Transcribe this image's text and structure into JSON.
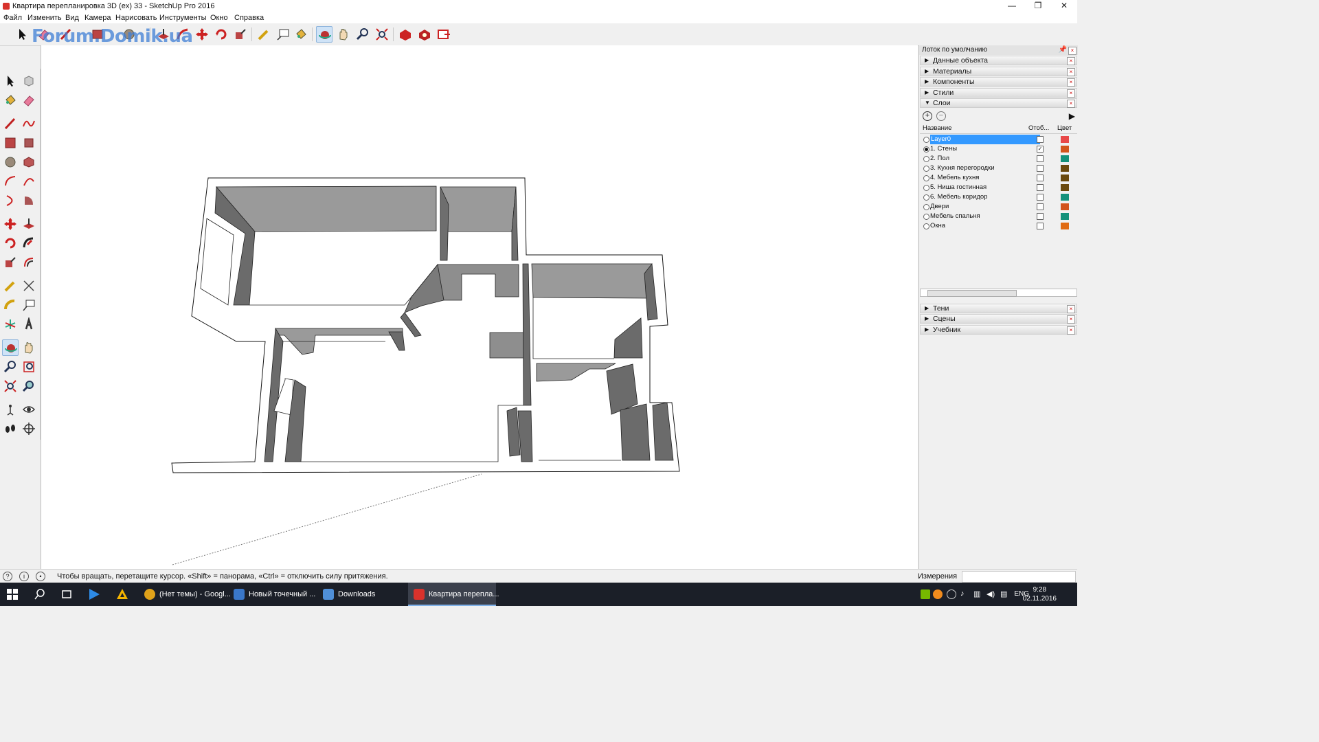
{
  "window": {
    "title": "Квартира перепланировка 3D (ex) 33 - SketchUp Pro 2016"
  },
  "menu": [
    "Файл",
    "Изменить",
    "Вид",
    "Камера",
    "Нарисовать",
    "Инструменты",
    "Окно",
    "Справка"
  ],
  "watermark": "Forum.Domik.ua",
  "tray": {
    "title": "Лоток по умолчанию",
    "panels_top": [
      "Данные объекта",
      "Материалы",
      "Компоненты",
      "Стили",
      "Слои"
    ],
    "panels_bottom": [
      "Тени",
      "Сцены",
      "Учебник"
    ],
    "layers_header": {
      "name": "Название",
      "visible": "Отоб...",
      "color": "Цвет"
    },
    "layers": [
      {
        "name": "Layer0",
        "active": false,
        "visible": false,
        "color": "#e84848",
        "selected": true
      },
      {
        "name": "1. Стены",
        "active": true,
        "visible": true,
        "color": "#d2541c",
        "selected": false
      },
      {
        "name": "2. Пол",
        "active": false,
        "visible": false,
        "color": "#14917a",
        "selected": false
      },
      {
        "name": "3. Кухня перегородки",
        "active": false,
        "visible": false,
        "color": "#6b4a0e",
        "selected": false
      },
      {
        "name": "4. Мебель кухня",
        "active": false,
        "visible": false,
        "color": "#6b4a0e",
        "selected": false
      },
      {
        "name": "5. Ниша гостинная",
        "active": false,
        "visible": false,
        "color": "#6b4a0e",
        "selected": false
      },
      {
        "name": "6. Мебель коридор",
        "active": false,
        "visible": false,
        "color": "#14917a",
        "selected": false
      },
      {
        "name": "Двери",
        "active": false,
        "visible": false,
        "color": "#d2541c",
        "selected": false
      },
      {
        "name": "Мебель спальня",
        "active": false,
        "visible": false,
        "color": "#14917a",
        "selected": false
      },
      {
        "name": "Окна",
        "active": false,
        "visible": false,
        "color": "#e06a12",
        "selected": false
      }
    ]
  },
  "status": {
    "hint": "Чтобы вращать, перетащите курсор. «Shift» = панорама, «Ctrl» = отключить силу притяжения.",
    "measurements_label": "Измерения",
    "measurements_value": ""
  },
  "taskbar": {
    "apps": [
      {
        "label": "(Нет темы) - Googl...",
        "color": "#e0a21a"
      },
      {
        "label": "Новый точечный ...",
        "color": "#3a77c9"
      },
      {
        "label": "Downloads",
        "color": "#4f8fd8"
      },
      {
        "label": "Квартира перепла...",
        "color": "#d8322c"
      }
    ],
    "lang": "ENG",
    "time": "9:28",
    "date": "02.11.2016"
  },
  "colors": {
    "wall_top": "#ffffff",
    "wall_dark": "#6b6b6b",
    "wall_mid": "#8e8e8e",
    "wall_light": "#b8b8b8",
    "selection": "#3399ff"
  }
}
